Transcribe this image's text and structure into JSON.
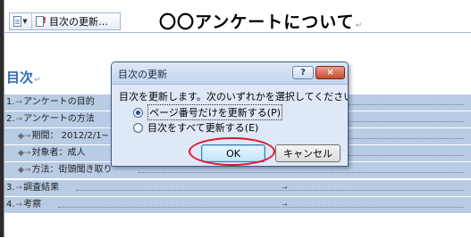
{
  "toolbar": {
    "update_label": "目次の更新…"
  },
  "document": {
    "title": "〇〇アンケートについて",
    "return_mark": "↵",
    "toc_heading": "目次"
  },
  "toc": [
    {
      "number": "1.",
      "text": "アンケートの目的"
    },
    {
      "number": "2.",
      "text": "アンケートの方法"
    },
    {
      "text": "期間： 2012/2/1~"
    },
    {
      "text": "対象者：成人"
    },
    {
      "text": "方法：街頭聞き取り"
    },
    {
      "number": "3.",
      "text": "調査結果"
    },
    {
      "number": "4.",
      "text": "考察"
    }
  ],
  "dialog": {
    "title": "目次の更新",
    "help_label": "?",
    "close_label": "×",
    "message": "目次を更新します。次のいずれかを選択してください：",
    "options": [
      {
        "label": "ページ番号だけを更新する(P)",
        "checked": true
      },
      {
        "label": "目次をすべて更新する(E)",
        "checked": false
      }
    ],
    "ok_label": "OK",
    "cancel_label": "キャンセル"
  },
  "colors": {
    "toc_highlight": "#b8cce4",
    "heading": "#2f6bb5",
    "annotation_red": "#e2142c"
  }
}
